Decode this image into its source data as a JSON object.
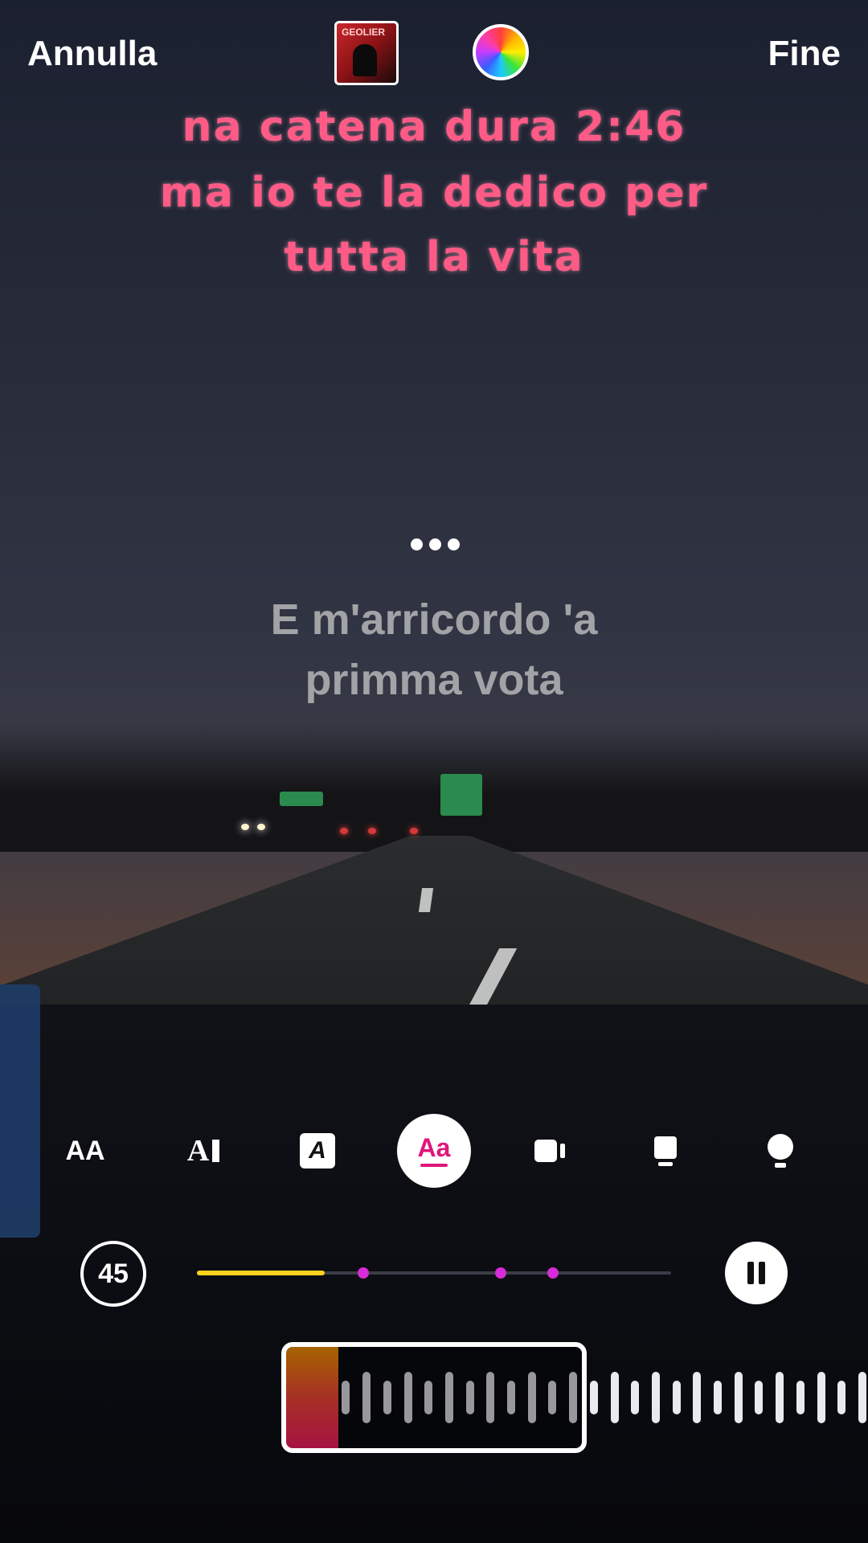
{
  "header": {
    "cancel_label": "Annulla",
    "done_label": "Fine",
    "album_art_name": "album-cover",
    "album_art_text": "GEOLIER",
    "color_picker_name": "color-wheel-icon"
  },
  "lyrics": {
    "highlighted_lines": [
      "na catena dura 2:46",
      "ma io te la dedico per",
      "tutta la vita"
    ],
    "highlight_color": "#ff5b86",
    "upcoming_lines": [
      "E m'arricordo 'a",
      "primma vota"
    ]
  },
  "style_toolbar": {
    "items": [
      {
        "name": "text-size-icon",
        "label": "AA"
      },
      {
        "name": "text-cursor-style-icon",
        "label": "A"
      },
      {
        "name": "italic-box-style-icon",
        "label": "A"
      },
      {
        "name": "aa-underline-style-icon",
        "label": "Aa",
        "active": true,
        "accent": "#e0167a"
      },
      {
        "name": "video-camera-icon"
      },
      {
        "name": "card-style-icon"
      },
      {
        "name": "bulb-style-icon"
      }
    ]
  },
  "player": {
    "duration_seconds": "45",
    "progress_fraction": 0.27,
    "marker_fractions": [
      0.35,
      0.64,
      0.75
    ],
    "progress_color": "#ffd21e",
    "marker_color": "#d62bd6"
  },
  "waveform": {
    "selection_gradient": [
      "#ff9a00",
      "#ff1f66"
    ]
  }
}
